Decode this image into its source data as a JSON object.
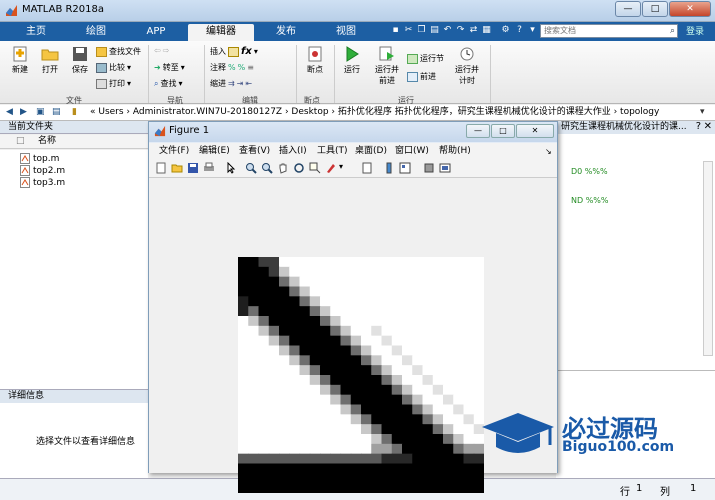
{
  "window": {
    "title": "MATLAB R2018a",
    "min": "—",
    "max": "□",
    "close": "✕"
  },
  "tabs": [
    "主页",
    "绘图",
    "APP",
    "编辑器",
    "发布",
    "视图"
  ],
  "search": {
    "placeholder": "搜索文档",
    "login": "登录"
  },
  "ribbon": {
    "new": "新建",
    "open": "打开",
    "save": "保存",
    "find_files": "查找文件",
    "compare": "比较",
    "print": "打印",
    "group_file": "文件",
    "goto": "转至",
    "find": "查找",
    "group_nav": "导航",
    "insert": "插入",
    "comment": "注释",
    "indent": "缩进",
    "fx": "fx",
    "group_edit": "编辑",
    "breakpoints": "断点",
    "group_bp": "断点",
    "run": "运行",
    "run_advance": [
      "运行并",
      "前进"
    ],
    "run_section": "运行节",
    "advance": "前进",
    "run_time": [
      "运行并",
      "计时"
    ],
    "group_run": "运行"
  },
  "address": {
    "path": "« Users › Administrator.WIN7U-20180127Z › Desktop › 拓扑优化程序 拓扑优化程序，研究生课程机械优化设计的课程大作业 › topology"
  },
  "file_panel": {
    "title": "当前文件夹",
    "col_name": "名称",
    "files": [
      "top.m",
      "top2.m",
      "top3.m"
    ],
    "details_title": "详细信息",
    "details_msg": "选择文件以查看详细信息"
  },
  "editor_panel": {
    "title": "研究生课程机械优化设计的课...",
    "code1": "D0 %%%",
    "code2": "ND %%%"
  },
  "figure": {
    "title": "Figure 1",
    "menu": [
      "文件(F)",
      "编辑(E)",
      "查看(V)",
      "插入(I)",
      "工具(T)",
      "桌面(D)",
      "窗口(W)",
      "帮助(H)"
    ]
  },
  "status": {
    "row_label": "行",
    "row_value": "1",
    "col_label": "列",
    "col_value": "1"
  },
  "watermark": {
    "line1": "必过源码",
    "line2": "Biguo100.com"
  },
  "colors": {
    "tabbar": "#1d5fa3",
    "accent": "#1a5aa8"
  }
}
